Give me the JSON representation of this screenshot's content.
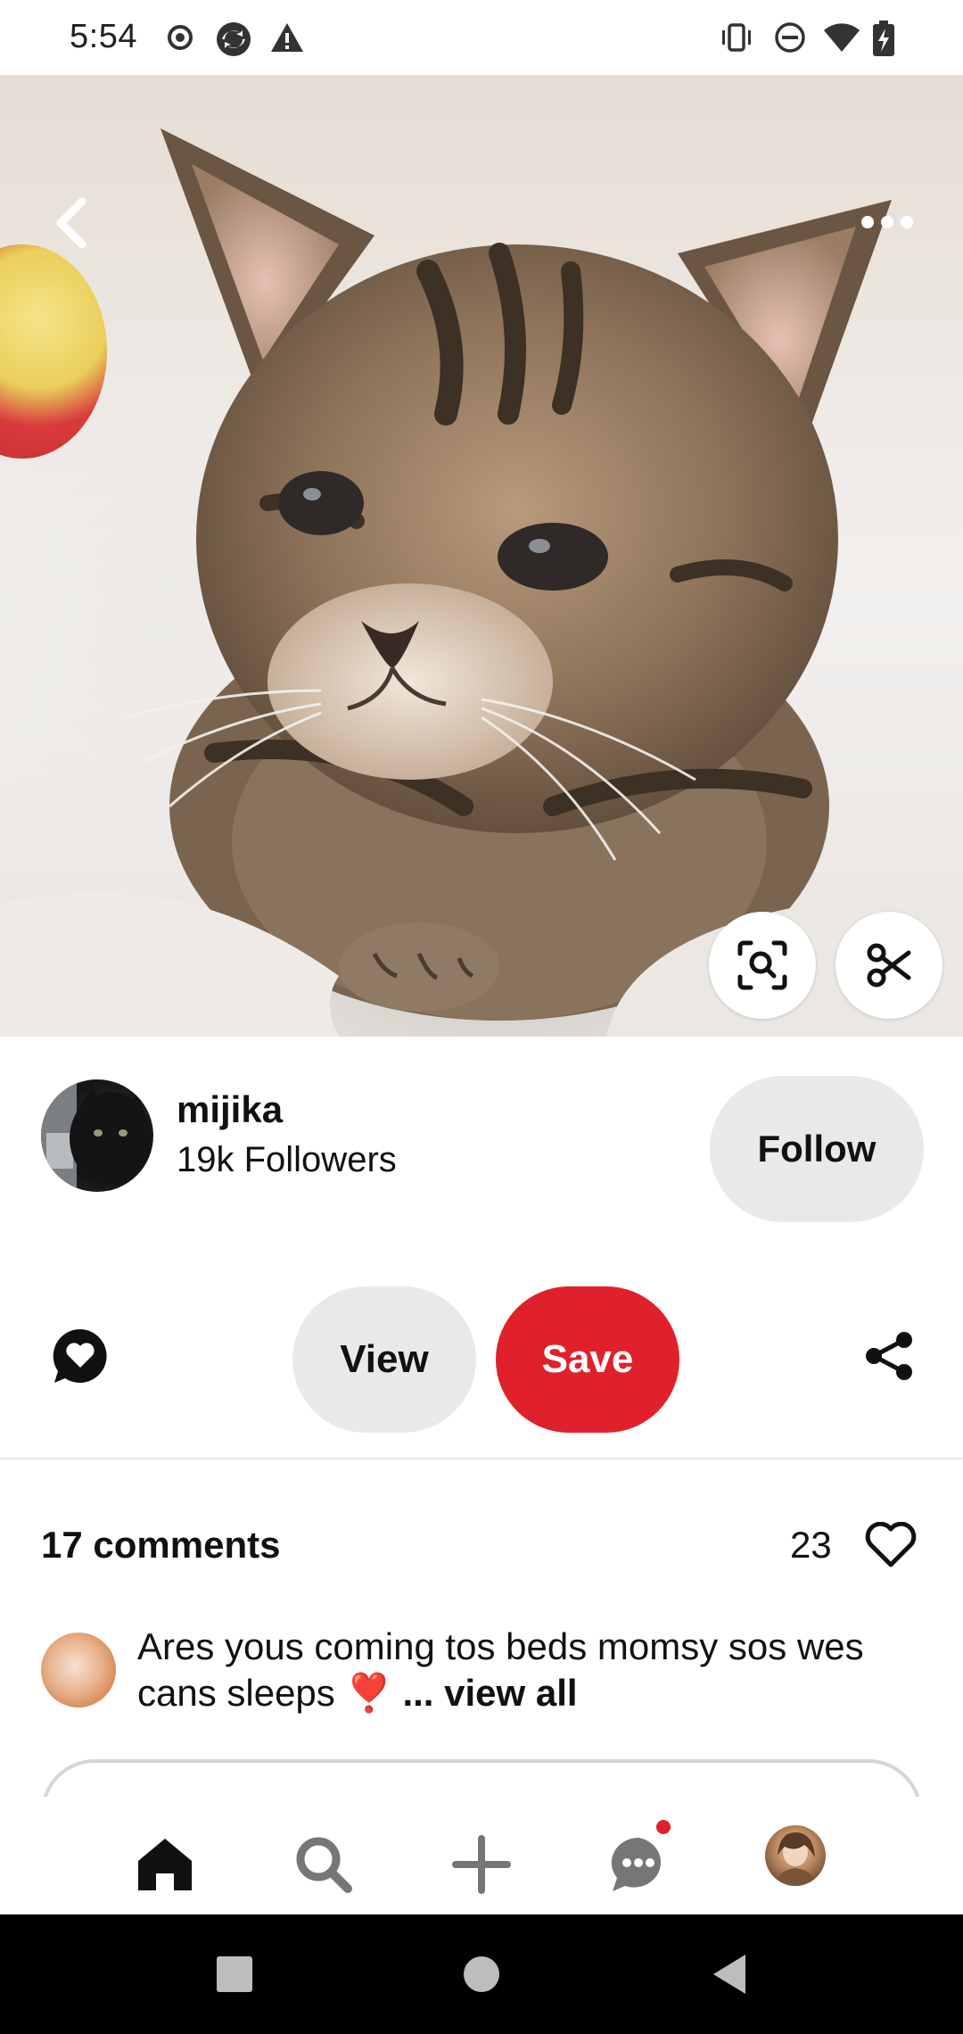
{
  "status_bar": {
    "time": "5:54",
    "left_icons": [
      "record-icon",
      "sync-icon",
      "warning-icon"
    ],
    "right_icons": [
      "vibrate-icon",
      "do-not-disturb-icon",
      "wifi-icon",
      "battery-charging-icon"
    ]
  },
  "hero": {
    "image": "tabby-kitten-photo",
    "top_left_icon": "back-chevron-icon",
    "top_right_icon": "more-options-icon",
    "overlay_buttons": [
      "visual-search-icon",
      "scissors-icon"
    ]
  },
  "creator": {
    "name": "mijika",
    "followers": "19k Followers",
    "follow_label": "Follow"
  },
  "actions": {
    "react_icon": "heart-chat-icon",
    "view_label": "View",
    "save_label": "Save",
    "share_icon": "share-icon"
  },
  "comments": {
    "count_label": "17 comments",
    "likes_count": "23",
    "first_comment": {
      "text": "Ares yous coming tos beds momsy sos wes cans sleeps ❣️ ",
      "view_all": "... view all"
    }
  },
  "bottom_nav": {
    "items": [
      "home-icon",
      "search-icon",
      "add-icon",
      "messages-icon",
      "profile-avatar"
    ],
    "notification_dot": true
  },
  "system_nav": [
    "recents-square-icon",
    "home-circle-icon",
    "back-triangle-icon"
  ],
  "colors": {
    "accent": "#e0212b",
    "pill_gray": "#e9e9e9",
    "text": "#111111"
  }
}
